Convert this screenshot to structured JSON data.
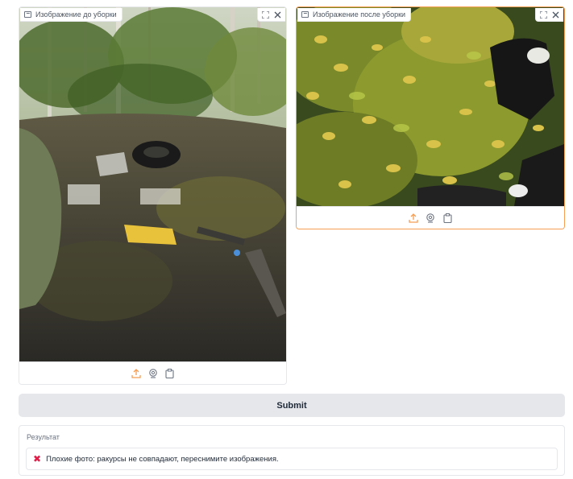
{
  "before_panel": {
    "label": "Изображение до уборки"
  },
  "after_panel": {
    "label": "Изображение после уборки"
  },
  "submit": {
    "label": "Submit"
  },
  "result": {
    "label": "Результат",
    "message": "Плохие фото: ракурсы не совпадают, переснимите изображения.",
    "status_icon": "x-mark-icon"
  },
  "colors": {
    "accent": "#f59e54",
    "error": "#e11d48",
    "button_bg": "#e5e7eb"
  }
}
